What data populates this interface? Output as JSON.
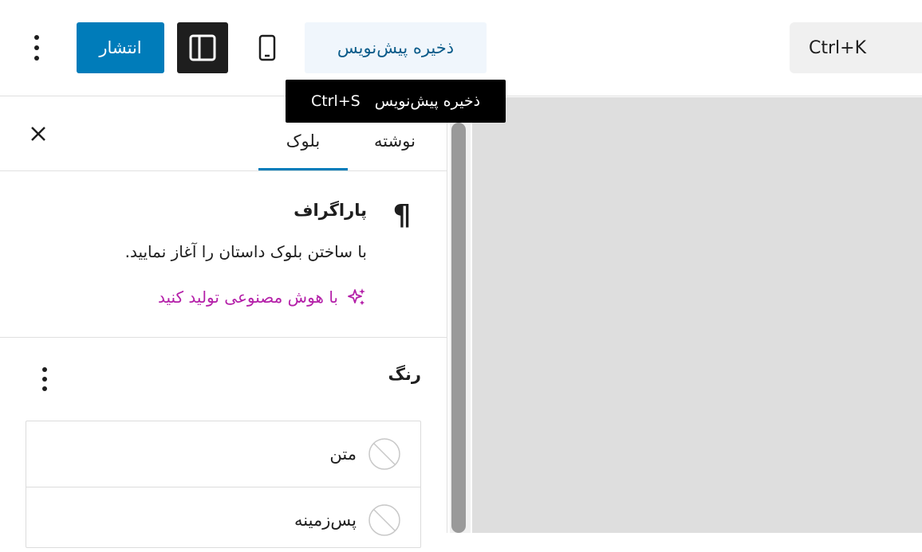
{
  "toolbar": {
    "more_icon": "kebab-vertical-icon",
    "publish_label": "انتشار",
    "sidebar_toggle_icon": "sidebar-icon",
    "preview_icon": "mobile-icon",
    "save_draft_label": "ذخیره پیش‌نویس",
    "command_shortcut": "Ctrl+K"
  },
  "tooltip": {
    "label": "ذخیره پیش‌نویس",
    "shortcut": "Ctrl+S"
  },
  "sidebar": {
    "tabs": [
      {
        "label": "نوشته",
        "active": false
      },
      {
        "label": "بلوک",
        "active": true
      }
    ],
    "close_icon": "close-icon",
    "block": {
      "icon": "pilcrow-icon",
      "title": "پاراگراف",
      "description": "با ساختن بلوک داستان را آغاز نمایید.",
      "ai_link": "با هوش مصنوعی تولید کنید",
      "ai_icon": "sparkle-icon"
    },
    "color_section": {
      "title": "رنگ",
      "options_icon": "kebab-vertical-icon",
      "items": [
        {
          "label": "متن",
          "swatch_icon": "no-color-icon"
        },
        {
          "label": "پس‌زمینه",
          "swatch_icon": "no-color-icon"
        }
      ]
    }
  },
  "colors": {
    "accent": "#007cba",
    "ai_link": "#b41fa8",
    "tooltip_bg": "#000000",
    "canvas_bg": "#dedede"
  }
}
